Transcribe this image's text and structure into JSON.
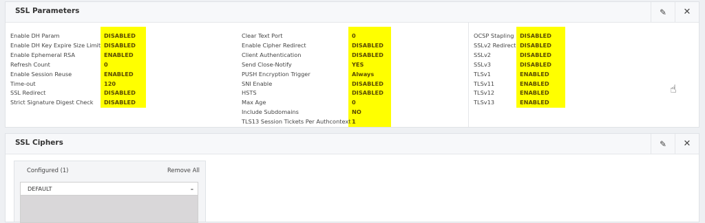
{
  "ssl_parameters": {
    "title": "SSL Parameters",
    "col1": [
      {
        "label": "Enable DH Param",
        "value": "DISABLED"
      },
      {
        "label": "Enable DH Key Expire Size Limit",
        "value": "DISABLED"
      },
      {
        "label": "Enable Ephemeral RSA",
        "value": "ENABLED"
      },
      {
        "label": "Refresh Count",
        "value": "0"
      },
      {
        "label": "Enable Session Reuse",
        "value": "ENABLED"
      },
      {
        "label": "Time-out",
        "value": "120"
      },
      {
        "label": "SSL Redirect",
        "value": "DISABLED"
      },
      {
        "label": "Strict Signature Digest Check",
        "value": "DISABLED"
      }
    ],
    "col2": [
      {
        "label": "Clear Text Port",
        "value": "0"
      },
      {
        "label": "Enable Cipher Redirect",
        "value": "DISABLED"
      },
      {
        "label": "Client Authentication",
        "value": "DISABLED"
      },
      {
        "label": "Send Close-Notify",
        "value": "YES"
      },
      {
        "label": "PUSH Encryption Trigger",
        "value": "Always"
      },
      {
        "label": "SNI Enable",
        "value": "DISABLED"
      },
      {
        "label": "HSTS",
        "value": "DISABLED"
      },
      {
        "label": "Max Age",
        "value": "0"
      },
      {
        "label": "Include Subdomains",
        "value": "NO"
      },
      {
        "label": "TLS13 Session Tickets Per Authcontext",
        "value": "1"
      }
    ],
    "col3": [
      {
        "label": "OCSP Stapling",
        "value": "DISABLED"
      },
      {
        "label": "SSLv2 Redirect",
        "value": "DISABLED"
      },
      {
        "label": "SSLv2",
        "value": "DISABLED"
      },
      {
        "label": "SSLv3",
        "value": "DISABLED"
      },
      {
        "label": "TLSv1",
        "value": "ENABLED"
      },
      {
        "label": "TLSv11",
        "value": "ENABLED"
      },
      {
        "label": "TLSv12",
        "value": "ENABLED"
      },
      {
        "label": "TLSv13",
        "value": "ENABLED"
      }
    ]
  },
  "ssl_ciphers": {
    "title": "SSL Ciphers",
    "configured_label": "Configured (1)",
    "remove_all_label": "Remove All",
    "items": [
      {
        "label": "DEFAULT",
        "remove": "–"
      }
    ]
  },
  "icons": {
    "edit": "pencil-icon",
    "close": "close-icon"
  },
  "colors": {
    "highlight": "#ffff00",
    "background": "#eef0f3"
  }
}
